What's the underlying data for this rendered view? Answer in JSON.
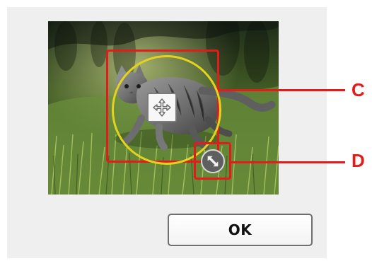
{
  "screen": {
    "ok_button_label": "OK"
  },
  "callouts": {
    "c_label": "C",
    "d_label": "D"
  },
  "colors": {
    "callout_red": "#e31b1b",
    "circle_yellow": "#e4d31d",
    "screen_background": "#efefef"
  },
  "icons": {
    "move": "move-icon",
    "resize": "resize-icon"
  }
}
